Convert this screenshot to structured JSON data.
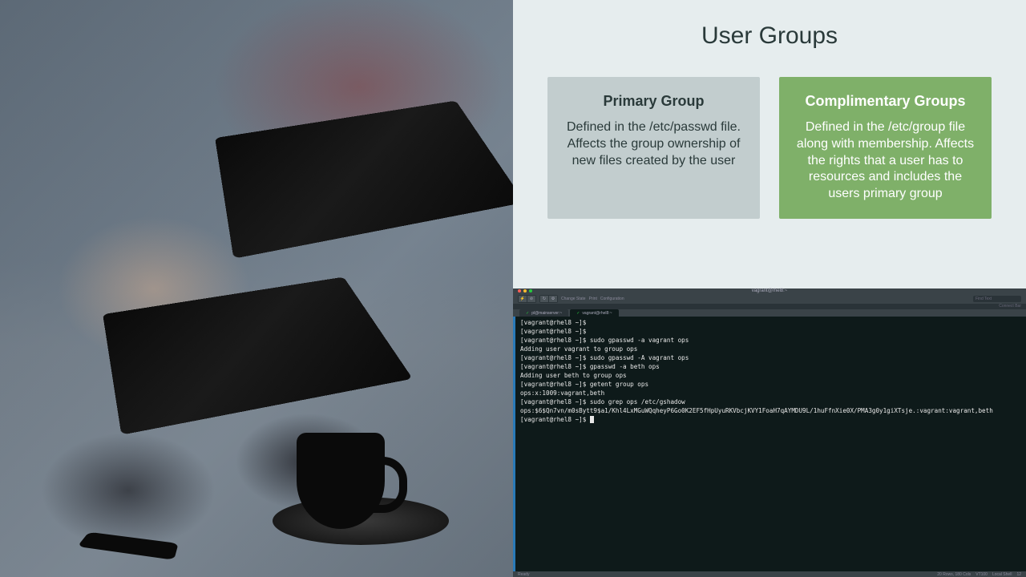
{
  "slide": {
    "title": "User Groups",
    "cards": [
      {
        "title": "Primary Group",
        "body": "Defined in the /etc/passwd file. Affects the group ownership of new files created by the user"
      },
      {
        "title": "Complimentary Groups",
        "body": "Defined in the /etc/group file along with membership. Affects the rights that a user has to resources and includes the users primary group"
      }
    ]
  },
  "terminal": {
    "window_title": "vagrant@rhel8:~",
    "toolbar": {
      "labels": [
        "Change State",
        "Print",
        "Configuration"
      ]
    },
    "find_placeholder": "Find Text",
    "command_bar": "Connect Bar",
    "tabs": [
      {
        "label": "pl@mainserver:~",
        "active": false
      },
      {
        "label": "vagrant@rhel8:~",
        "active": true
      }
    ],
    "prompt": "[vagrant@rhel8 ~]$",
    "lines": [
      {
        "prompt": true,
        "text": ""
      },
      {
        "prompt": true,
        "text": ""
      },
      {
        "prompt": true,
        "text": " sudo gpasswd -a vagrant ops"
      },
      {
        "prompt": false,
        "text": "Adding user vagrant to group ops"
      },
      {
        "prompt": true,
        "text": " sudo gpasswd -A vagrant ops"
      },
      {
        "prompt": true,
        "text": " gpasswd -a beth ops"
      },
      {
        "prompt": false,
        "text": "Adding user beth to group ops"
      },
      {
        "prompt": true,
        "text": " getent group ops"
      },
      {
        "prompt": false,
        "text": "ops:x:1009:vagrant,beth"
      },
      {
        "prompt": true,
        "text": " sudo grep ops /etc/gshadow"
      },
      {
        "prompt": false,
        "text": "ops:$6$Qn7vn/m0sBytt9$a1/Khl4LxMGuWQqheyP6Go0K2EF5fHpUyuRKVbcjKVY1FoaH7qAYMDU9L/1huFfnXie0X/PMA3g0y1giXTsje.:vagrant:vagrant,beth"
      },
      {
        "prompt": true,
        "text": " ",
        "cursor": true
      }
    ],
    "status": {
      "left": "Ready",
      "right": [
        "20 Rows, 180 Cols",
        "VT100",
        "Local Shell",
        "12"
      ]
    }
  }
}
